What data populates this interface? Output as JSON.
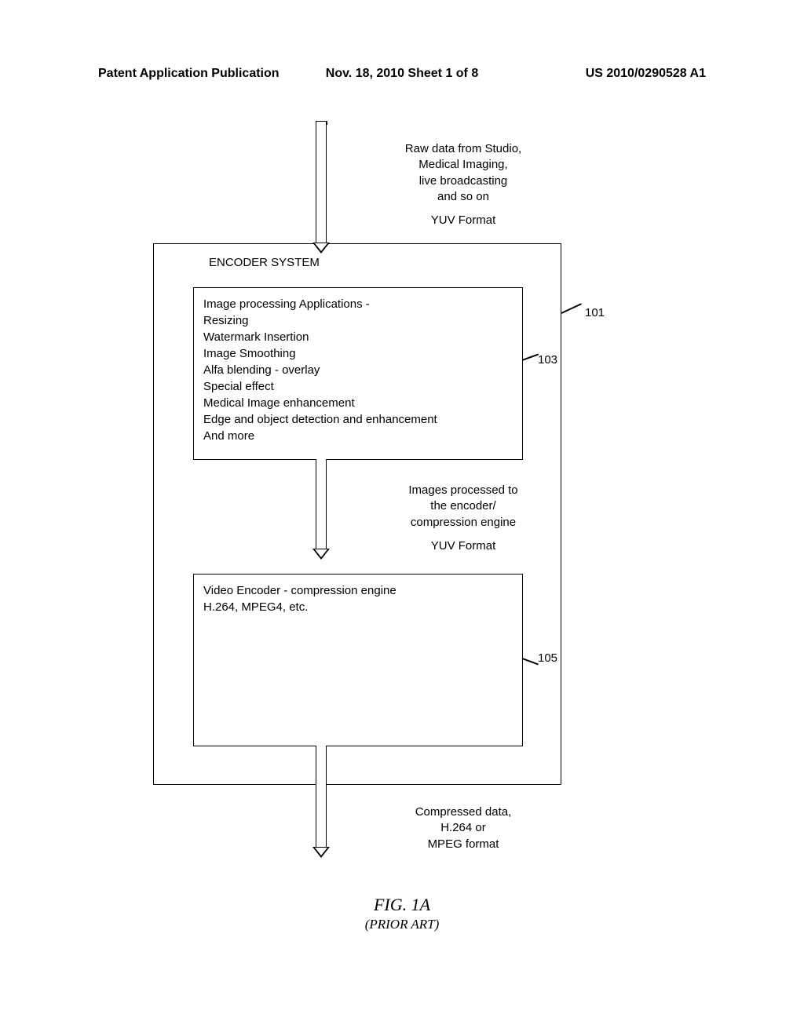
{
  "header": {
    "left": "Patent Application Publication",
    "center": "Nov. 18, 2010  Sheet 1 of 8",
    "right": "US 2010/0290528 A1"
  },
  "labels": {
    "input": {
      "line1": "Raw data from Studio,",
      "line2": "Medical Imaging,",
      "line3": "live broadcasting",
      "line4": "and so on",
      "line5": "YUV Format"
    },
    "mid": {
      "line1": "Images processed to",
      "line2": "the encoder/",
      "line3": "compression engine",
      "line4": "YUV Format"
    },
    "out": {
      "line1": "Compressed data,",
      "line2": "H.264 or",
      "line3": "MPEG format"
    }
  },
  "encoder": {
    "title": "ENCODER SYSTEM"
  },
  "box103": {
    "line1": "Image processing Applications -",
    "line2": "Resizing",
    "line3": "Watermark Insertion",
    "line4": "Image Smoothing",
    "line5": "Alfa blending - overlay",
    "line6": "Special effect",
    "line7": "Medical Image enhancement",
    "line8": "Edge and object detection and enhancement",
    "line9": "And more"
  },
  "box105": {
    "line1": "Video Encoder - compression engine",
    "line2": "H.264, MPEG4, etc."
  },
  "refs": {
    "r101": "101",
    "r103": "103",
    "r105": "105"
  },
  "figure": {
    "caption": "FIG. 1A",
    "sub": "(PRIOR ART)"
  }
}
